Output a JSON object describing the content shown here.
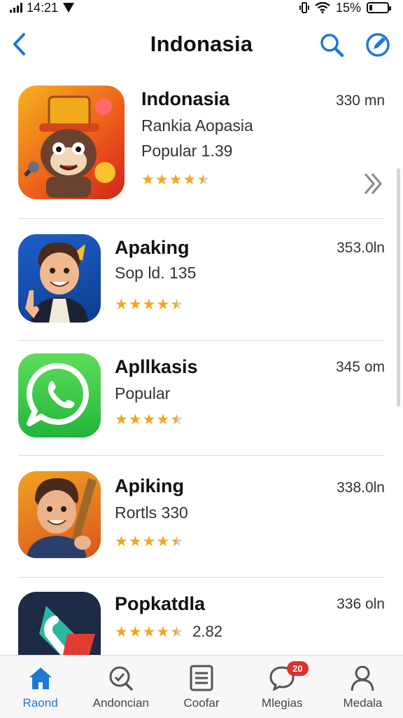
{
  "status_bar": {
    "time": "14:21",
    "battery": "15%",
    "battery_level": 0.15
  },
  "nav": {
    "title": "Indonasia",
    "icons": {
      "back": "chevron-left-icon",
      "search": "search-icon",
      "compose": "compose-icon"
    }
  },
  "apps": [
    {
      "name": "Indonasia",
      "subtitle": "Rankia Aopasia",
      "subtitle2": "Popular 1.39",
      "size": "330 mn",
      "rating": 4.5,
      "icon": "cartoon-mascot-icon",
      "accessory": "chevron-right-icon"
    },
    {
      "name": "Apaking",
      "subtitle": "Sop ld. 135",
      "size": "353.0ln",
      "rating": 4.5,
      "icon": "cartoon-man-icon"
    },
    {
      "name": "Apllkasis",
      "subtitle": "Popular",
      "size": "345 om",
      "rating": 4.5,
      "icon": "whatsapp-icon"
    },
    {
      "name": "Apiking",
      "subtitle": "Rortls 330",
      "size": "338.0ln",
      "rating": 4.5,
      "icon": "cartoon-man-icon"
    },
    {
      "name": "Popkatdla",
      "rating_text": "2.82",
      "size": "336 oln",
      "rating": 4.5,
      "icon": "phone-app-icon"
    }
  ],
  "tabs": [
    {
      "label": "Raond",
      "icon": "home-icon",
      "active": true
    },
    {
      "label": "Andoncian",
      "icon": "search-check-icon",
      "active": false
    },
    {
      "label": "Coofar",
      "icon": "document-icon",
      "active": false
    },
    {
      "label": "Mlegias",
      "icon": "chat-icon",
      "active": false,
      "badge": "20"
    },
    {
      "label": "Medala",
      "icon": "person-icon",
      "active": false
    }
  ],
  "colors": {
    "accent": "#1f78d6",
    "star": "#f5a51c",
    "badge": "#e0302a"
  }
}
